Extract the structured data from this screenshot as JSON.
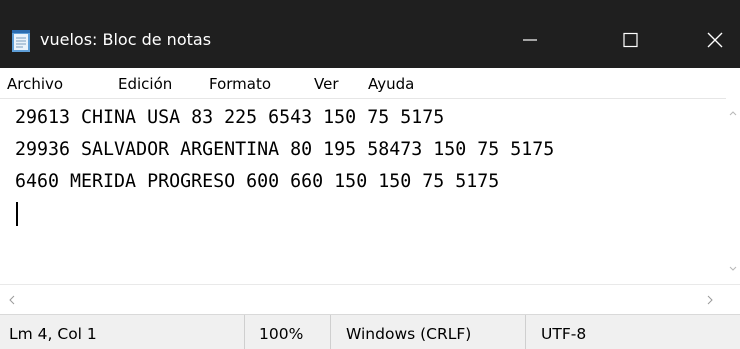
{
  "window": {
    "title": "vuelos: Bloc de notas",
    "app_icon": "notepad-icon",
    "controls": {
      "minimize_icon": "minimize-icon",
      "maximize_icon": "maximize-icon",
      "close_icon": "close-icon"
    }
  },
  "menu": {
    "items": [
      "Archivo",
      "Edición",
      "Formato",
      "Ver",
      "Ayuda"
    ]
  },
  "editor": {
    "lines": [
      "29613 CHINA USA 83 225 6543 150 75 5175",
      "29936 SALVADOR ARGENTINA 80 195 58473 150 75 5175",
      "6460 MERIDA PROGRESO 600 660 150 150 75 5175",
      ""
    ]
  },
  "statusbar": {
    "position": "Lm 4, Col 1",
    "zoom": "100%",
    "line_ending": "Windows (CRLF)",
    "encoding": "UTF-8"
  },
  "colors": {
    "titlebar_bg": "#1f1f1f",
    "statusbar_bg": "#f0f0f0"
  }
}
